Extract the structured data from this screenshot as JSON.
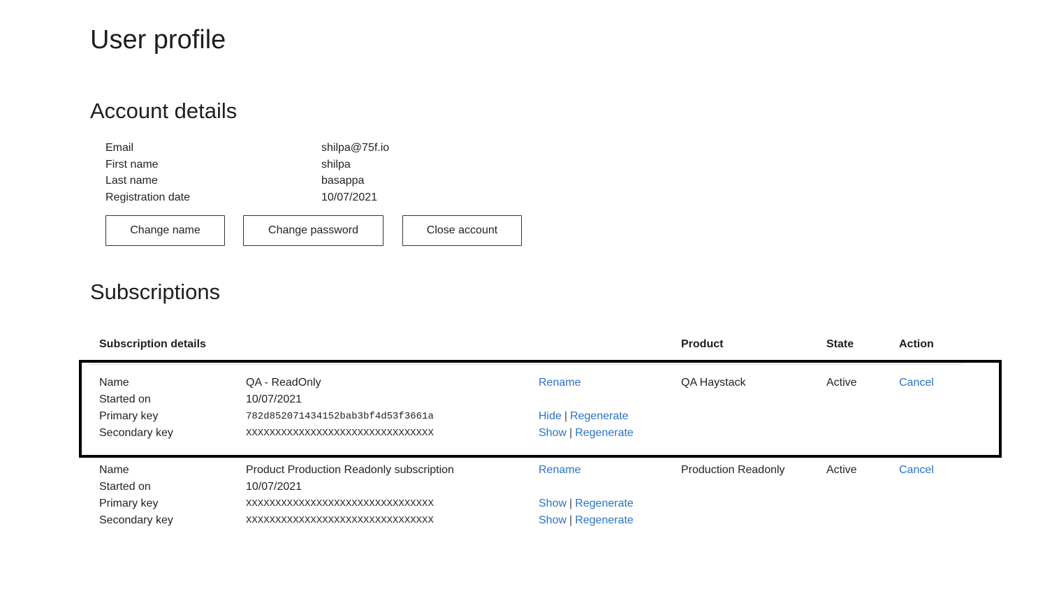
{
  "page_title": "User profile",
  "account": {
    "title": "Account details",
    "rows": [
      {
        "label": "Email",
        "value": "shilpa@75f.io"
      },
      {
        "label": "First name",
        "value": "shilpa"
      },
      {
        "label": "Last name",
        "value": "basappa"
      },
      {
        "label": "Registration date",
        "value": "10/07/2021"
      }
    ],
    "buttons": {
      "change_name": "Change name",
      "change_password": "Change password",
      "close_account": "Close account"
    }
  },
  "subscriptions": {
    "title": "Subscriptions",
    "headers": {
      "details": "Subscription details",
      "product": "Product",
      "state": "State",
      "action": "Action"
    },
    "labels": {
      "name": "Name",
      "started_on": "Started on",
      "primary_key": "Primary key",
      "secondary_key": "Secondary key"
    },
    "link_labels": {
      "rename": "Rename",
      "regenerate": "Regenerate",
      "separator": "|"
    },
    "items": [
      {
        "name": "QA - ReadOnly",
        "started_on": "10/07/2021",
        "primary_key": "782d852071434152bab3bf4d53f3661a",
        "primary_toggle": "Hide",
        "secondary_key": "XXXXXXXXXXXXXXXXXXXXXXXXXXXXXXXX",
        "secondary_toggle": "Show",
        "product": "QA Haystack",
        "state": "Active",
        "action": "Cancel"
      },
      {
        "name": "Product Production Readonly subscription",
        "started_on": "10/07/2021",
        "primary_key": "XXXXXXXXXXXXXXXXXXXXXXXXXXXXXXXX",
        "primary_toggle": "Show",
        "secondary_key": "XXXXXXXXXXXXXXXXXXXXXXXXXXXXXXXX",
        "secondary_toggle": "Show",
        "product": "Production Readonly",
        "state": "Active",
        "action": "Cancel"
      }
    ]
  }
}
